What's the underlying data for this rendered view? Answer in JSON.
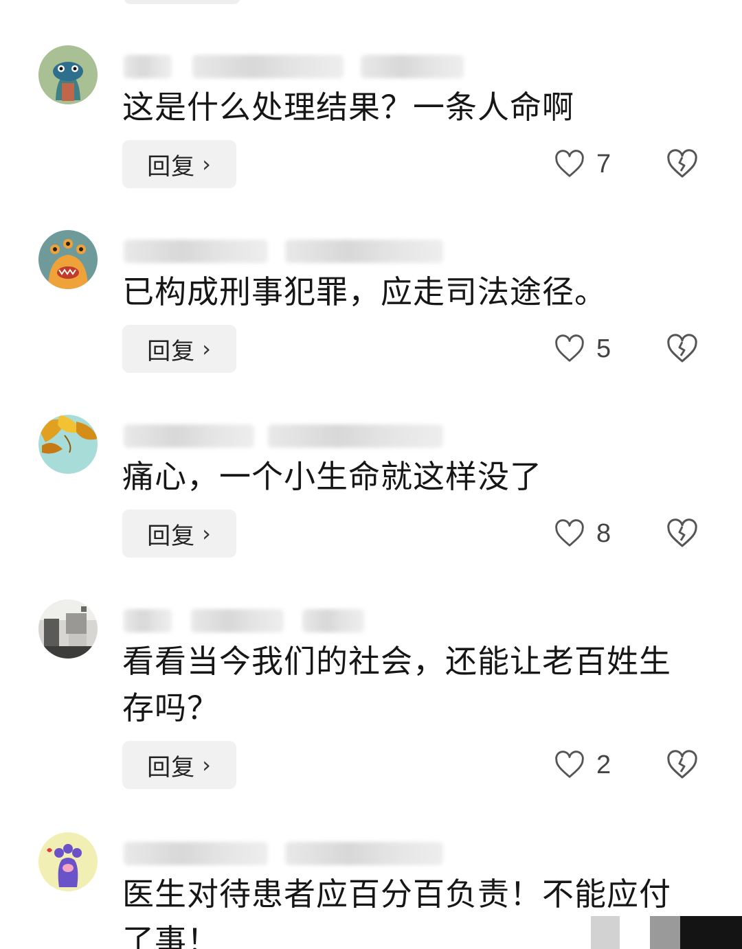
{
  "actions": {
    "reply_label": "回复",
    "reply_chevron": "›"
  },
  "icons": {
    "like": "heart-outline-icon",
    "dislike": "broken-heart-icon",
    "chevron": "chevron-right-icon"
  },
  "colors": {
    "background": "#ffffff",
    "reply_button_bg": "#f1f1f1",
    "text": "#161616",
    "icon": "#555555"
  },
  "comments": [
    {
      "text": "这是什么处理结果？一条人命啊",
      "likes": "7",
      "avatar": "green-alien-avatar"
    },
    {
      "text": "已构成刑事犯罪，应走司法途径。",
      "likes": "5",
      "avatar": "orange-monster-avatar"
    },
    {
      "text": "痛心，一个小生命就这样没了",
      "likes": "8",
      "avatar": "yellow-leaves-avatar"
    },
    {
      "text": "看看当今我们的社会，还能让老百姓生存吗？",
      "likes": "2",
      "avatar": "room-photo-avatar"
    },
    {
      "text": "医生对待患者应百分百负责！不能应付了事！",
      "avatar": "purple-paw-avatar"
    }
  ]
}
